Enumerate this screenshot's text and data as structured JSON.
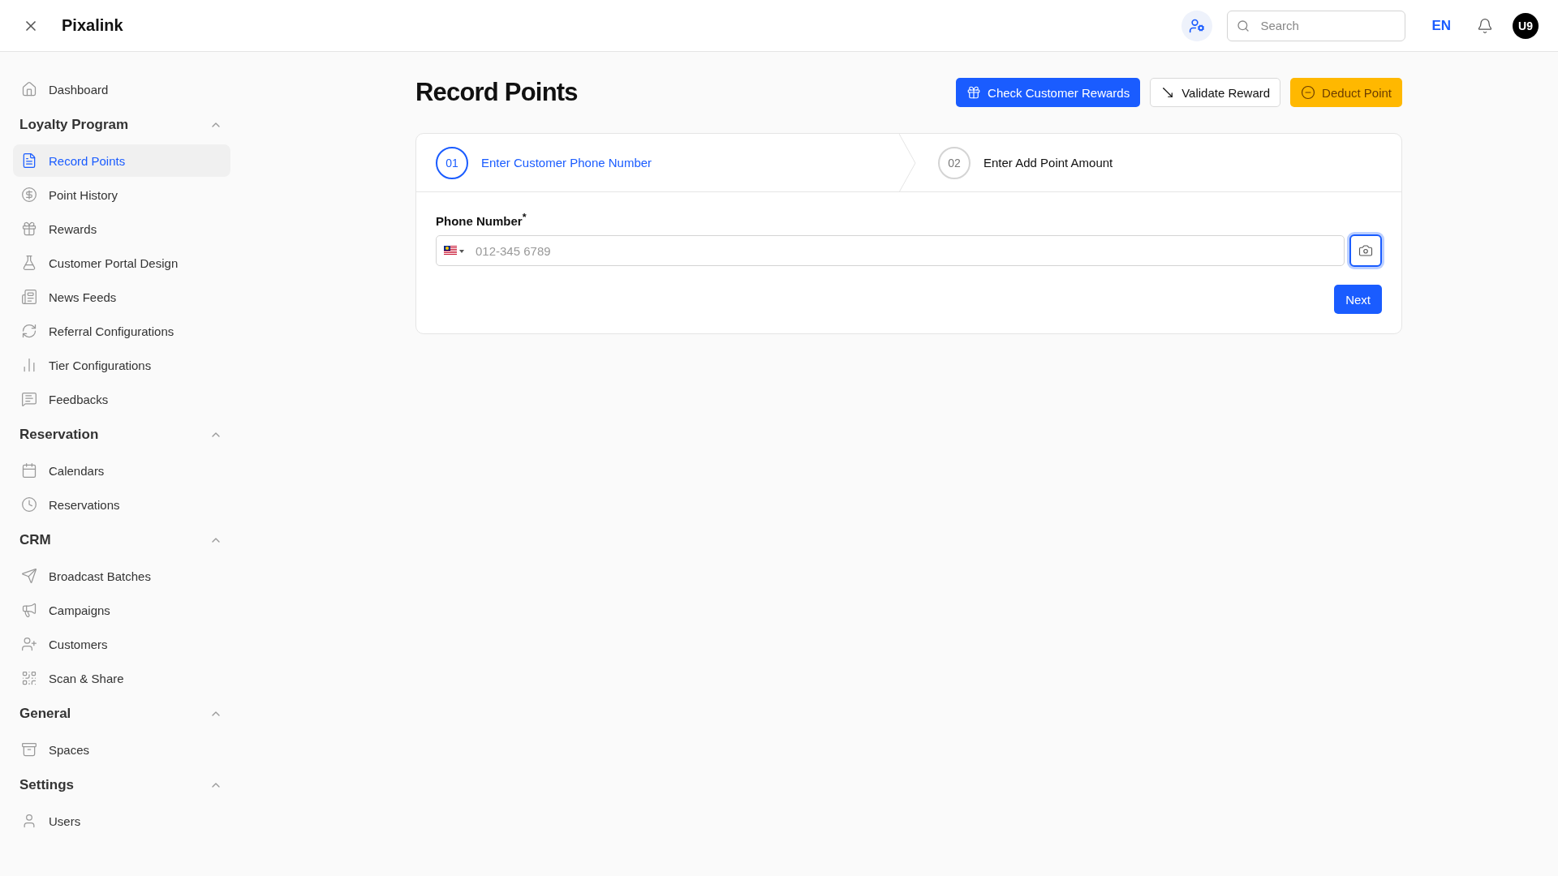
{
  "topbar": {
    "title": "Pixalink",
    "search": {
      "placeholder": "Search"
    },
    "language": "EN",
    "avatar": "U9"
  },
  "sidebar": [
    {
      "kind": "item",
      "label": "Dashboard",
      "selected": false
    },
    {
      "kind": "group",
      "label": "Loyalty Program",
      "expanded": true,
      "children": [
        {
          "label": "Record Points",
          "selected": true
        },
        {
          "label": "Point History",
          "selected": false
        },
        {
          "label": "Rewards",
          "selected": false
        },
        {
          "label": "Customer Portal Design",
          "selected": false
        },
        {
          "label": "News Feeds",
          "selected": false
        },
        {
          "label": "Referral Configurations",
          "selected": false
        },
        {
          "label": "Tier Configurations",
          "selected": false
        },
        {
          "label": "Feedbacks",
          "selected": false
        }
      ]
    },
    {
      "kind": "group",
      "label": "Reservation",
      "expanded": true,
      "children": [
        {
          "label": "Calendars",
          "selected": false
        },
        {
          "label": "Reservations",
          "selected": false
        }
      ]
    },
    {
      "kind": "group",
      "label": "CRM",
      "expanded": true,
      "children": [
        {
          "label": "Broadcast Batches",
          "selected": false
        },
        {
          "label": "Campaigns",
          "selected": false
        },
        {
          "label": "Customers",
          "selected": false
        },
        {
          "label": "Scan & Share",
          "selected": false
        }
      ]
    },
    {
      "kind": "group",
      "label": "General",
      "expanded": true,
      "children": [
        {
          "label": "Spaces",
          "selected": false
        }
      ]
    },
    {
      "kind": "group",
      "label": "Settings",
      "expanded": true,
      "children": [
        {
          "label": "Users",
          "selected": false
        }
      ]
    }
  ],
  "page": {
    "title": "Record Points",
    "actions": [
      {
        "kind": "primary",
        "label": "Check Customer Rewards"
      },
      {
        "kind": "outline",
        "label": "Validate Reward"
      },
      {
        "kind": "warning",
        "label": "Deduct Point"
      }
    ],
    "steps": [
      {
        "number": "01",
        "label": "Enter Customer Phone Number",
        "selected": true
      },
      {
        "number": "02",
        "label": "Enter Add Point Amount",
        "selected": false
      }
    ],
    "form": {
      "label": "Phone Number",
      "required_mark": "*",
      "placeholder": "012-345 6789",
      "submit": "Next"
    }
  }
}
